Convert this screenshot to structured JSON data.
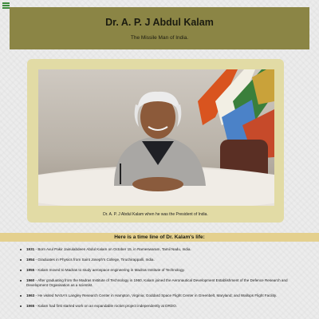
{
  "header": {
    "title": "Dr. A. P. J Abdul Kalam",
    "subtitle": "The Missile Man of India."
  },
  "photo": {
    "caption": "Dr. A. P. J Abdul Kalam when he was the President of India."
  },
  "timeline": {
    "heading": "Here is a time line of Dr. Kalam's life:",
    "items": [
      {
        "year": "1931",
        "text": " - Born Avul Pakir Jainulabdeen Abdul Kalam on October 15, in Rameswaram, Tamil Nadu, India."
      },
      {
        "year": "1954",
        "text": " - Graduates in Physics from Saint Joseph's College, Tiruchirappalli, India."
      },
      {
        "year": "1955",
        "text": " - Kalam moved to Madras to study aerospace engineering in Madras Institute of Technology."
      },
      {
        "year": "1960",
        "text": " - After graduating from the Madras Institute of Technology in 1960, Kalam joined the Aeronautical Development Establishment of the Defence Research and Development Organisation as a scientist."
      },
      {
        "year": "1963",
        "text": " - He visited NASA's Langley Research Center in Hampton, Virginia; Goddard Space Flight Center in Greenbelt, Maryland; and Wallops Flight Facility."
      },
      {
        "year": "1965",
        "text": " - Kalam had first started work on an expandable rocket project independently at DRDO."
      }
    ]
  }
}
